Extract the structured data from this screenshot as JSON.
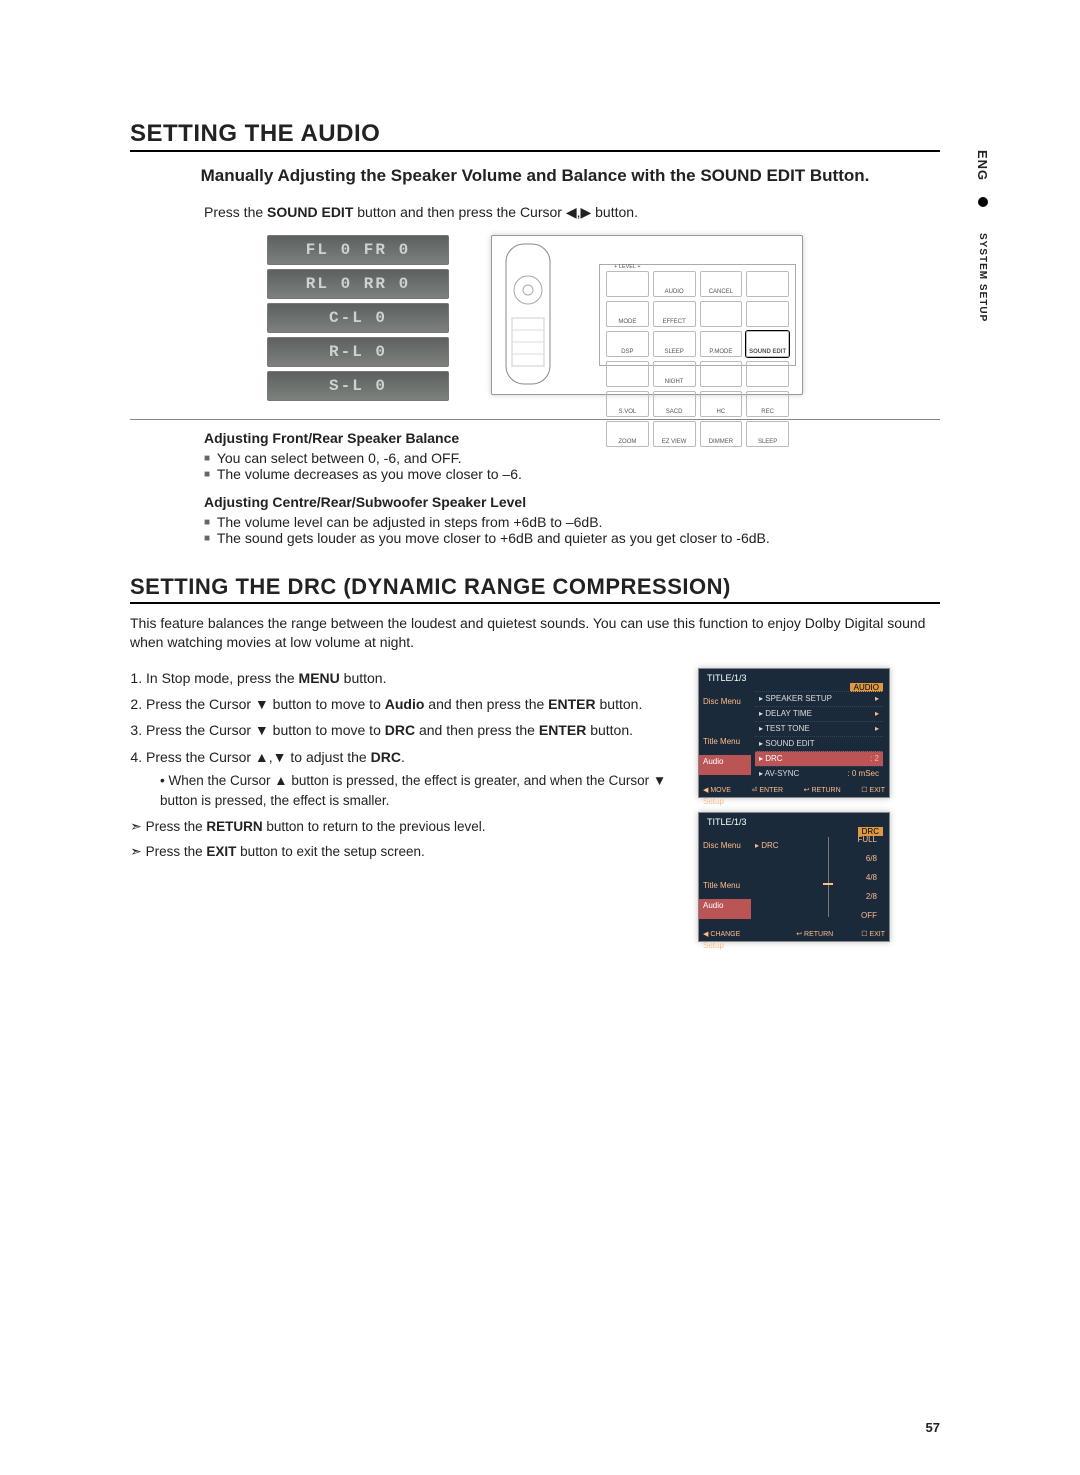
{
  "side_tab": {
    "lang": "ENG",
    "section": "SYSTEM SETUP"
  },
  "h1": "SETTING THE AUDIO",
  "subhead": "Manually Adjusting the Speaker Volume and Balance with the SOUND EDIT Button.",
  "press_line_pre": "Press the ",
  "press_line_bold": "SOUND EDIT",
  "press_line_mid": " button and then press the Cursor ◀,▶ button.",
  "lcd": [
    "FL 0  FR 0",
    "RL 0  RR 0",
    "C-L   0",
    "R-L   0",
    "S-L   0"
  ],
  "remote_buttons": [
    {
      "top": "+ LEVEL +",
      "label": ""
    },
    {
      "top": "",
      "label": "AUDIO"
    },
    {
      "top": "",
      "label": "CANCEL"
    },
    {
      "top": "",
      "label": ""
    },
    {
      "top": "",
      "label": "MODE"
    },
    {
      "top": "",
      "label": "EFFECT"
    },
    {
      "top": "",
      "label": ""
    },
    {
      "top": "",
      "label": ""
    },
    {
      "top": "",
      "label": "DSP"
    },
    {
      "top": "",
      "label": "SLEEP"
    },
    {
      "top": "",
      "label": "P.MODE"
    },
    {
      "top": "",
      "label": "SOUND EDIT",
      "hl": true
    },
    {
      "top": "",
      "label": ""
    },
    {
      "top": "",
      "label": "NIGHT"
    },
    {
      "top": "",
      "label": ""
    },
    {
      "top": "",
      "label": ""
    },
    {
      "top": "",
      "label": "S.VOL"
    },
    {
      "top": "",
      "label": "SACD"
    },
    {
      "top": "",
      "label": "HC"
    },
    {
      "top": "",
      "label": "REC"
    },
    {
      "top": "",
      "label": "ZOOM"
    },
    {
      "top": "",
      "label": "EZ VIEW"
    },
    {
      "top": "",
      "label": "DIMMER"
    },
    {
      "top": "",
      "label": "SLEEP"
    }
  ],
  "sec1_title": "Adjusting Front/Rear Speaker Balance",
  "sec1_items": [
    "You can select between 0, -6, and OFF.",
    "The volume decreases as you move closer to –6."
  ],
  "sec2_title": "Adjusting Centre/Rear/Subwoofer Speaker Level",
  "sec2_items": [
    "The volume level can be adjusted in steps from +6dB to –6dB.",
    "The sound gets louder as you move closer to +6dB and quieter as you get closer to -6dB."
  ],
  "h2": "SETTING THE DRC (DYNAMIC RANGE COMPRESSION)",
  "intro": "This feature balances the range between the loudest and quietest sounds. You can use this function to enjoy Dolby Digital sound when watching movies at low volume at night.",
  "steps": [
    {
      "pre": "In Stop mode, press the ",
      "b": "MENU",
      "post": " button."
    },
    {
      "pre": "Press the Cursor ▼ button to move to ",
      "b": "Audio",
      "post": " and then press the ",
      "b2": "ENTER",
      "post2": " button."
    },
    {
      "pre": "Press the Cursor ▼ button to move to ",
      "b": "DRC",
      "post": " and then press the ",
      "b2": "ENTER",
      "post2": " button."
    },
    {
      "pre": "Press the Cursor ▲,▼ to adjust the ",
      "b": "DRC",
      "post": "."
    }
  ],
  "step4_note": "When the Cursor ▲ button is pressed, the effect is greater, and when the Cursor ▼ button is pressed, the effect is smaller.",
  "arrow_lines": [
    {
      "pre": "Press the ",
      "b": "RETURN",
      "post": " button to return to the previous level."
    },
    {
      "pre": "Press the ",
      "b": "EXIT",
      "post": " button to exit the setup screen."
    }
  ],
  "osd1": {
    "title": "TITLE/1/3",
    "panel": "AUDIO",
    "side": [
      "Disc Menu",
      "",
      "Title Menu",
      "Audio",
      "",
      "Setup"
    ],
    "rows": [
      {
        "lab": "▸ SPEAKER SETUP",
        "val": "▸"
      },
      {
        "lab": "▸ DELAY TIME",
        "val": "▸"
      },
      {
        "lab": "▸ TEST TONE",
        "val": "▸"
      },
      {
        "lab": "▸ SOUND EDIT",
        "val": ""
      },
      {
        "lab": "▸ DRC",
        "val": ": 2",
        "sel": true
      },
      {
        "lab": "▸ AV-SYNC",
        "val": ": 0 mSec"
      }
    ],
    "footer": [
      "◀ MOVE",
      "⏎ ENTER",
      "↩ RETURN",
      "☐ EXIT"
    ]
  },
  "osd2": {
    "title": "TITLE/1/3",
    "panel": "DRC",
    "side": [
      "Disc Menu",
      "",
      "Title Menu",
      "Audio",
      "",
      "Setup"
    ],
    "drc_label": "▸ DRC",
    "scale": [
      "FULL",
      "6/8",
      "4/8",
      "2/8",
      "OFF"
    ],
    "footer": [
      "◀ CHANGE",
      "",
      "↩ RETURN",
      "☐ EXIT"
    ]
  },
  "page_number": "57"
}
